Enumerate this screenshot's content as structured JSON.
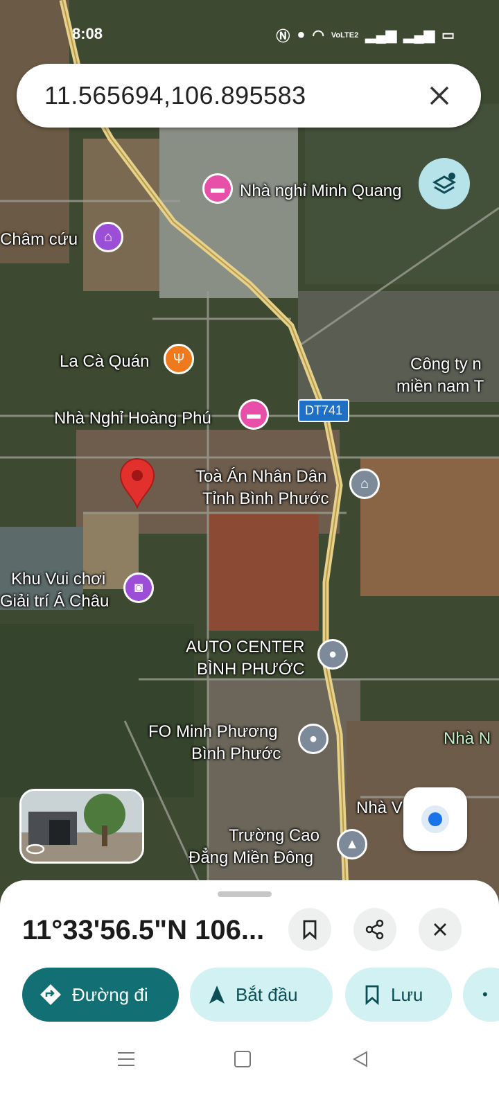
{
  "status_bar": {
    "time": "8:08",
    "network": "VoLTE2"
  },
  "search": {
    "query": "11.565694,106.895583"
  },
  "map": {
    "road_label": "DT741",
    "pois": [
      {
        "name": "Nhà nghỉ Minh Quang",
        "icon": "hotel-icon",
        "color": "#e84fa8"
      },
      {
        "name": "Châm cứu",
        "icon": "temple-icon",
        "color": "#9a4fd6"
      },
      {
        "name": "La Cà Quán",
        "icon": "restaurant-icon",
        "color": "#f07a1b"
      },
      {
        "name": "Nhà Nghỉ Hoàng Phú",
        "icon": "hotel-icon",
        "color": "#e84fa8"
      },
      {
        "name_line1": "Toà Án Nhân Dân",
        "name_line2": "Tỉnh Bình Phước",
        "icon": "government-icon",
        "color": "#7d8a99"
      },
      {
        "name_line1": "Công ty n",
        "name_line2": "miền nam T"
      },
      {
        "name_line1": "Khu Vui chơi",
        "name_line2": "Giải trí Á Châu",
        "icon": "camera-icon",
        "color": "#9a4fd6"
      },
      {
        "name_line1": "AUTO CENTER",
        "name_line2": "BÌNH PHƯỚC",
        "icon": "place-icon",
        "color": "#7d8a99"
      },
      {
        "name_line1": "FO Minh Phương",
        "name_line2": "Bình Phước",
        "icon": "place-icon",
        "color": "#7d8a99"
      },
      {
        "name_line1": "Trường Cao",
        "name_line2": "Đẳng Miền Đông",
        "icon": "school-icon",
        "color": "#7d8a99"
      },
      {
        "name": "Nhà V    Kh"
      },
      {
        "name": "Nhà N"
      }
    ]
  },
  "sheet": {
    "title": "11°33'56.5\"N 106...",
    "actions": {
      "directions": "Đường đi",
      "start": "Bắt đầu",
      "save": "Lưu"
    }
  },
  "colors": {
    "accent": "#127074",
    "chip_bg": "#d2f1f3",
    "pin": "#e2312d"
  }
}
